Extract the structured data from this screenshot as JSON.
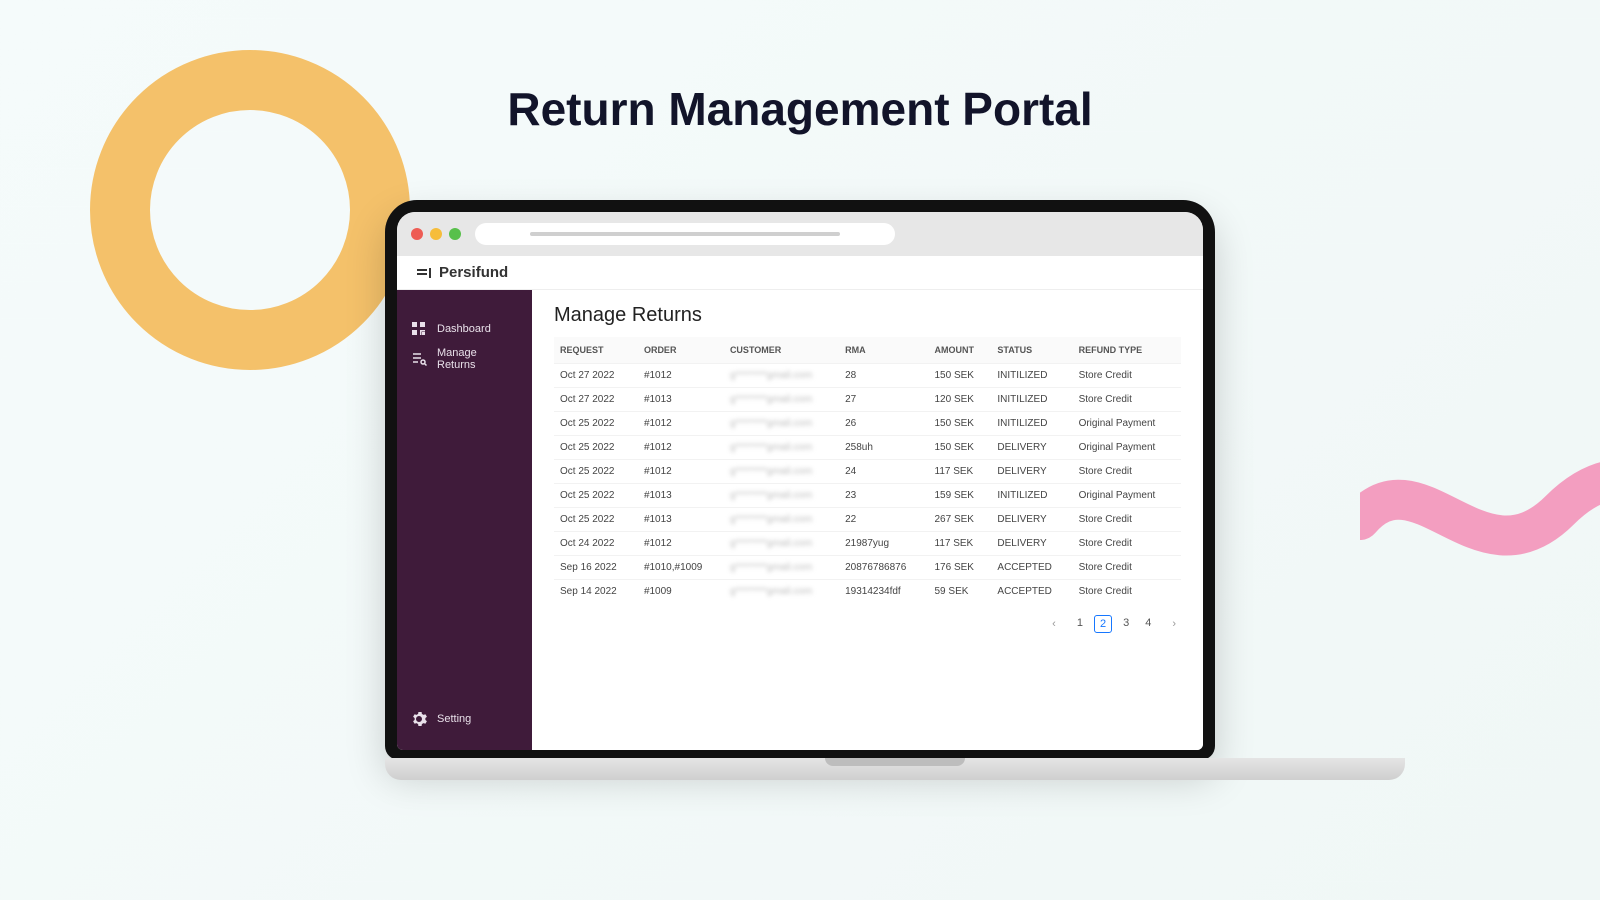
{
  "hero": {
    "title": "Return Management Portal"
  },
  "brand": {
    "name": "Persifund"
  },
  "sidebar": {
    "dashboard": "Dashboard",
    "manage_returns": "Manage Returns",
    "setting": "Setting"
  },
  "page": {
    "title": "Manage Returns"
  },
  "table": {
    "headers": {
      "request": "REQUEST",
      "order": "ORDER",
      "customer": "CUSTOMER",
      "rma": "RMA",
      "amount": "AMOUNT",
      "status": "STATUS",
      "refund_type": "REFUND TYPE"
    },
    "rows": [
      {
        "request": "Oct 27 2022",
        "order": "#1012",
        "customer": "g********gmail.com",
        "rma": "28",
        "amount": "150 SEK",
        "status": "INITILIZED",
        "refund_type": "Store Credit"
      },
      {
        "request": "Oct 27 2022",
        "order": "#1013",
        "customer": "g********gmail.com",
        "rma": "27",
        "amount": "120 SEK",
        "status": "INITILIZED",
        "refund_type": "Store Credit"
      },
      {
        "request": "Oct 25 2022",
        "order": "#1012",
        "customer": "g********gmail.com",
        "rma": "26",
        "amount": "150 SEK",
        "status": "INITILIZED",
        "refund_type": "Original Payment"
      },
      {
        "request": "Oct 25 2022",
        "order": "#1012",
        "customer": "g********gmail.com",
        "rma": "258uh",
        "amount": "150 SEK",
        "status": "DELIVERY",
        "refund_type": "Original Payment"
      },
      {
        "request": "Oct 25 2022",
        "order": "#1012",
        "customer": "g********gmail.com",
        "rma": "24",
        "amount": "117 SEK",
        "status": "DELIVERY",
        "refund_type": "Store Credit"
      },
      {
        "request": "Oct 25 2022",
        "order": "#1013",
        "customer": "g********gmail.com",
        "rma": "23",
        "amount": "159 SEK",
        "status": "INITILIZED",
        "refund_type": "Original Payment"
      },
      {
        "request": "Oct 25 2022",
        "order": "#1013",
        "customer": "g********gmail.com",
        "rma": "22",
        "amount": "267 SEK",
        "status": "DELIVERY",
        "refund_type": "Store Credit"
      },
      {
        "request": "Oct 24 2022",
        "order": "#1012",
        "customer": "g********gmail.com",
        "rma": "21987yug",
        "amount": "117 SEK",
        "status": "DELIVERY",
        "refund_type": "Store Credit"
      },
      {
        "request": "Sep 16 2022",
        "order": "#1010,#1009",
        "customer": "g********gmail.com",
        "rma": "20876786876",
        "amount": "176 SEK",
        "status": "ACCEPTED",
        "refund_type": "Store Credit"
      },
      {
        "request": "Sep 14 2022",
        "order": "#1009",
        "customer": "g********gmail.com",
        "rma": "19314234fdf",
        "amount": "59 SEK",
        "status": "ACCEPTED",
        "refund_type": "Store Credit"
      }
    ]
  },
  "pagination": {
    "pages": [
      "1",
      "2",
      "3",
      "4"
    ],
    "active": "2"
  }
}
